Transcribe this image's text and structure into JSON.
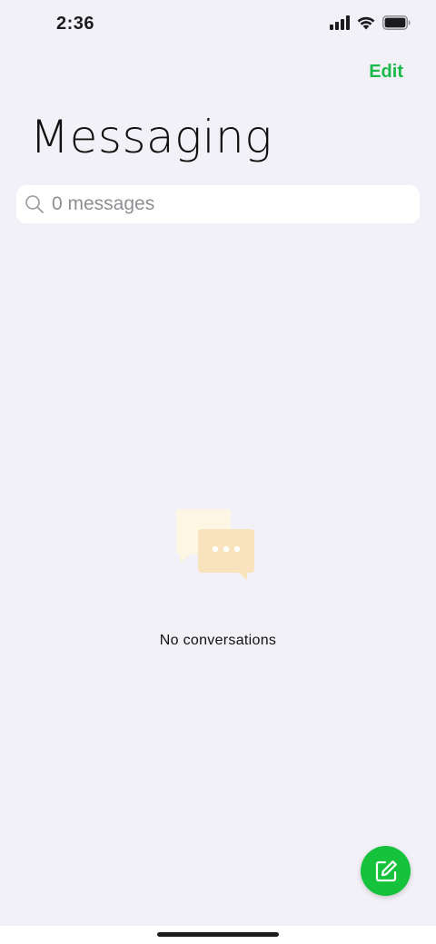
{
  "status_bar": {
    "time": "2:36",
    "icons": [
      "cellular-signal-icon",
      "wifi-icon",
      "battery-icon"
    ]
  },
  "header": {
    "edit_label": "Edit",
    "title": "Messaging"
  },
  "search": {
    "placeholder": "0 messages",
    "value": ""
  },
  "empty_state": {
    "icon": "chat-bubbles-icon",
    "message": "No conversations"
  },
  "fab": {
    "icon": "compose-icon"
  },
  "colors": {
    "accent": "#1BB94A",
    "fab": "#16C13B",
    "background": "#F2F1F7",
    "search_bg": "#FFFFFF",
    "placeholder": "#8E8E93"
  }
}
